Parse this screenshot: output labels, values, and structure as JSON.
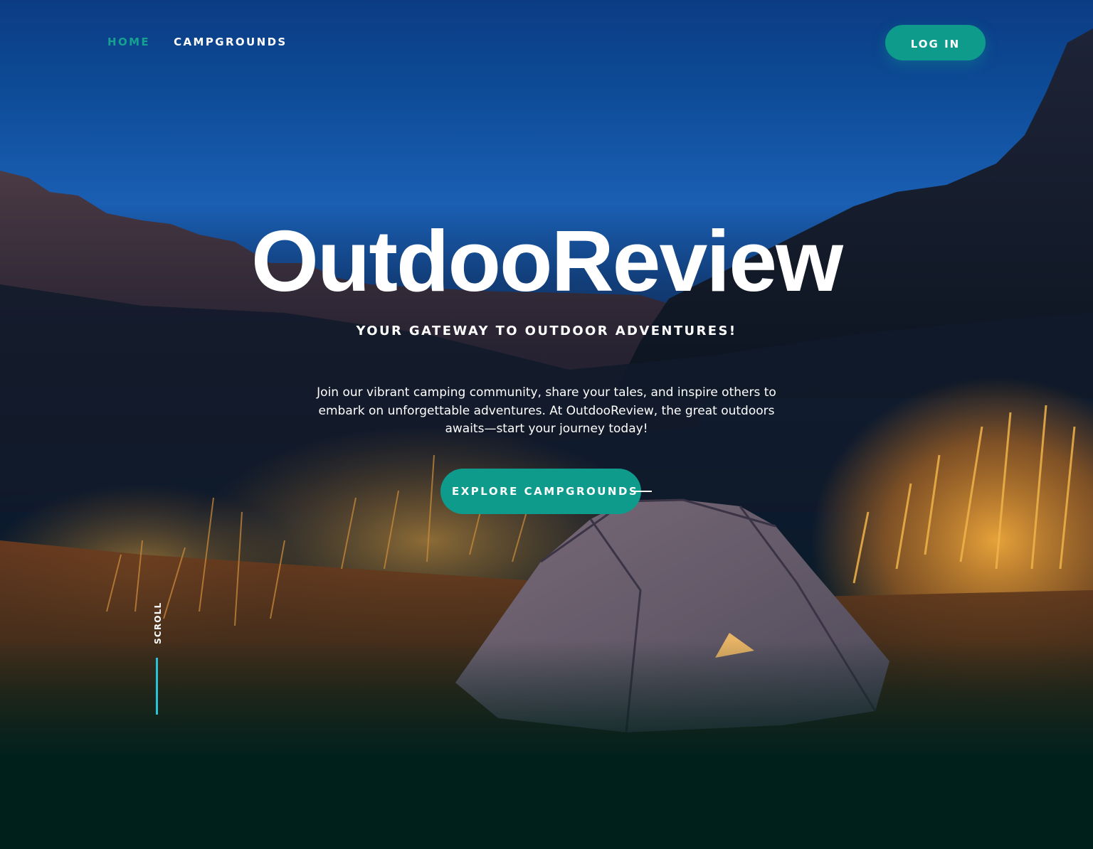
{
  "nav": {
    "items": [
      {
        "label": "HOME",
        "active": true
      },
      {
        "label": "CAMPGROUNDS",
        "active": false
      }
    ],
    "login_label": "LOG IN"
  },
  "hero": {
    "title": "OutdooReview",
    "tagline": "YOUR GATEWAY TO OUTDOOR ADVENTURES!",
    "blurb": "Join our vibrant camping community, share your tales, and inspire others to embark on unforgettable adventures. At OutdooReview, the great outdoors awaits—start your journey today!",
    "cta_label": "EXPLORE  CAMPGROUNDS",
    "scroll_label": "SCROLL"
  },
  "colors": {
    "accent": "#0e9b8c",
    "nav_active": "#14a192",
    "scroll_line": "#27c3d6",
    "footer_dark": "#00201c"
  },
  "icons": {
    "cta_trailing": "dash-line-icon"
  }
}
